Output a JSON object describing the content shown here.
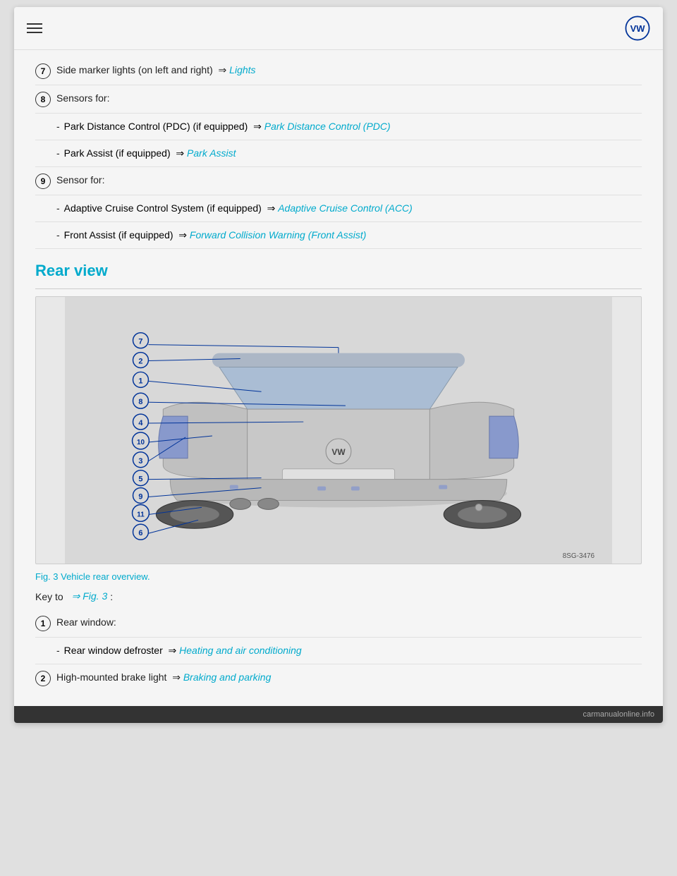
{
  "header": {
    "menu_icon": "hamburger",
    "logo": "VW"
  },
  "items": [
    {
      "num": "7",
      "text": "Side marker lights (on left and right)",
      "arrow": "⇒",
      "link_text": "Lights",
      "has_sub": false
    },
    {
      "num": "8",
      "text": "Sensors for:",
      "has_sub": true,
      "sub_items": [
        {
          "text": "Park Distance Control (PDC) (if equipped)",
          "arrow": "⇒",
          "link_text": "Park Distance Control (PDC)"
        },
        {
          "text": "Park Assist (if equipped)",
          "arrow": "⇒",
          "link_text": "Park Assist"
        }
      ]
    },
    {
      "num": "9",
      "text": "Sensor for:",
      "has_sub": true,
      "sub_items": [
        {
          "text": "Adaptive Cruise Control System (if equipped)",
          "arrow": "⇒",
          "link_text": "Adaptive Cruise Control (ACC)"
        },
        {
          "text": "Front Assist (if equipped)",
          "arrow": "⇒",
          "link_text": "Forward Collision Warning (Front Assist)"
        }
      ]
    }
  ],
  "rear_view": {
    "section_title": "Rear view",
    "fig_caption": "Fig. 3 Vehicle rear overview.",
    "key_to_prefix": "Key to",
    "key_to_fig": "⇒ Fig. 3",
    "key_to_suffix": ":",
    "fig_code": "8SG-3476"
  },
  "rear_items": [
    {
      "num": "1",
      "text": "Rear window:",
      "has_sub": true,
      "sub_items": [
        {
          "text": "Rear window defroster",
          "arrow": "⇒",
          "link_text": "Heating and air conditioning"
        }
      ]
    },
    {
      "num": "2",
      "text": "High-mounted brake light",
      "arrow": "⇒",
      "link_text": "Braking and parking",
      "has_sub": false
    }
  ],
  "labels": {
    "lights": "Lights",
    "park_distance": "Park Distance Control (PDC)",
    "park_assist": "Park Assist",
    "acc": "Adaptive Cruise Control (ACC)",
    "front_assist": "Forward Collision Warning (Front Assist)",
    "heating": "Heating and air conditioning",
    "braking": "Braking and parking"
  }
}
